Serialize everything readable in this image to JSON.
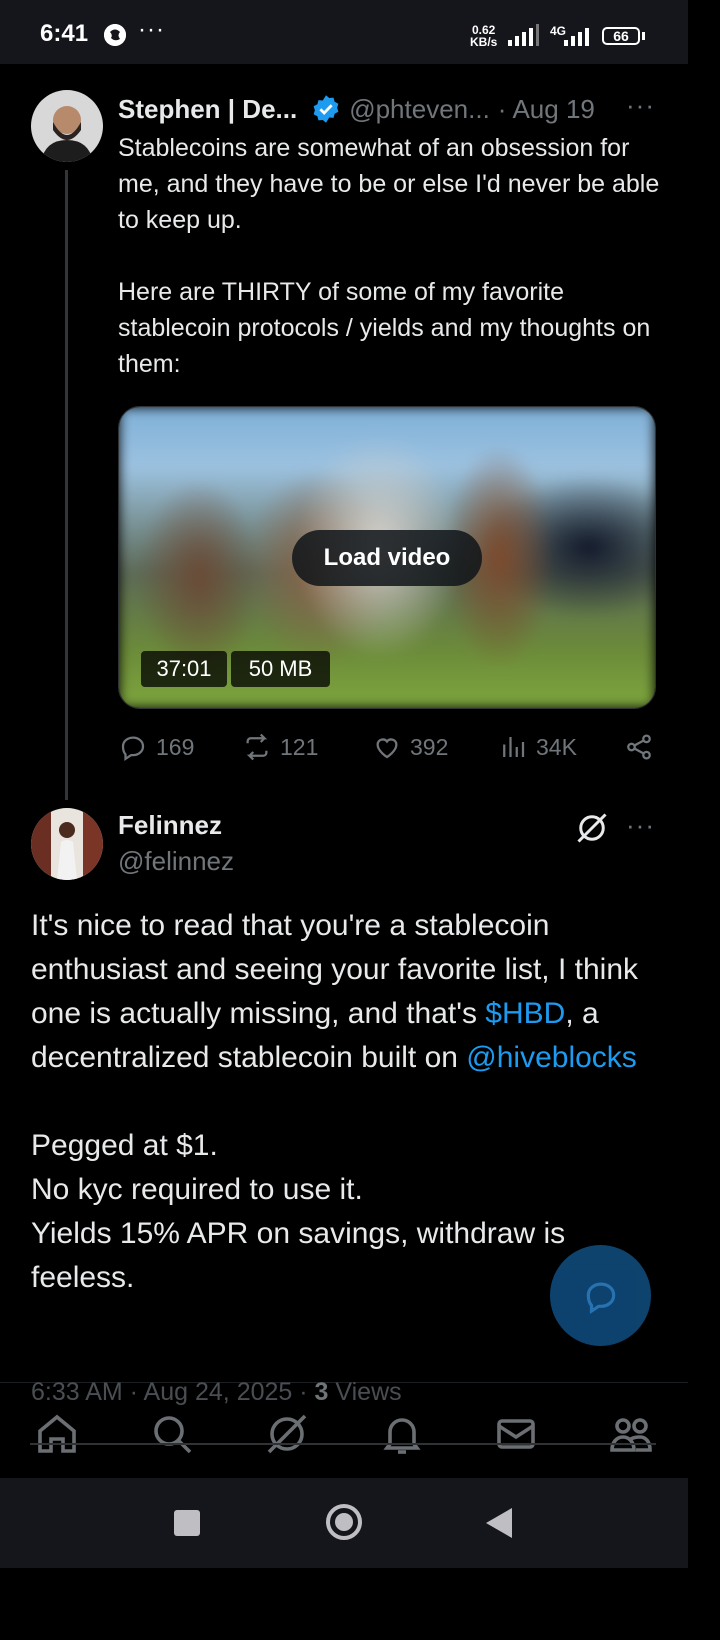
{
  "status_bar": {
    "time": "6:41",
    "dots": "···",
    "net_speed_value": "0.62",
    "net_speed_unit": "KB/s",
    "network_type": "4G",
    "battery": "66"
  },
  "tweet": {
    "author_name": "Stephen | De...",
    "handle": "@phteven...",
    "separator": "·",
    "date": "Aug 19",
    "more": "···",
    "text_lines": [
      "Stablecoins are somewhat of an obsession for me, and they have to be or else I'd never be able to keep up.",
      "Here are THIRTY of some of my favorite stablecoin protocols / yields and my thoughts on them:"
    ],
    "media": {
      "load_label": "Load video",
      "duration": "37:01",
      "size": "50 MB"
    },
    "stats": {
      "replies": "169",
      "retweets": "121",
      "likes": "392",
      "views": "34K"
    }
  },
  "reply": {
    "author_name": "Felinnez",
    "handle": "@felinnez",
    "more": "···",
    "text_part1": "It's nice to read that you're a stablecoin enthusiast and seeing your favorite list, I think one is actually missing, and that's ",
    "cashtag": "$HBD",
    "text_part2": ", a decentralized stablecoin built on ",
    "mention": "@hiveblocks",
    "line_pegged": "Pegged at $1.",
    "line_kyc": "No kyc required to use it.",
    "line_yield": "Yields 15% APR on savings, withdraw is feeless.",
    "timestamp": "6:33 AM · Aug 24, 2025 · ",
    "views_count": "3",
    "views_label": " Views"
  },
  "colors": {
    "background": "#000000",
    "link": "#1d9bf0",
    "muted": "#71767b",
    "verified": "#1d9bf0"
  }
}
